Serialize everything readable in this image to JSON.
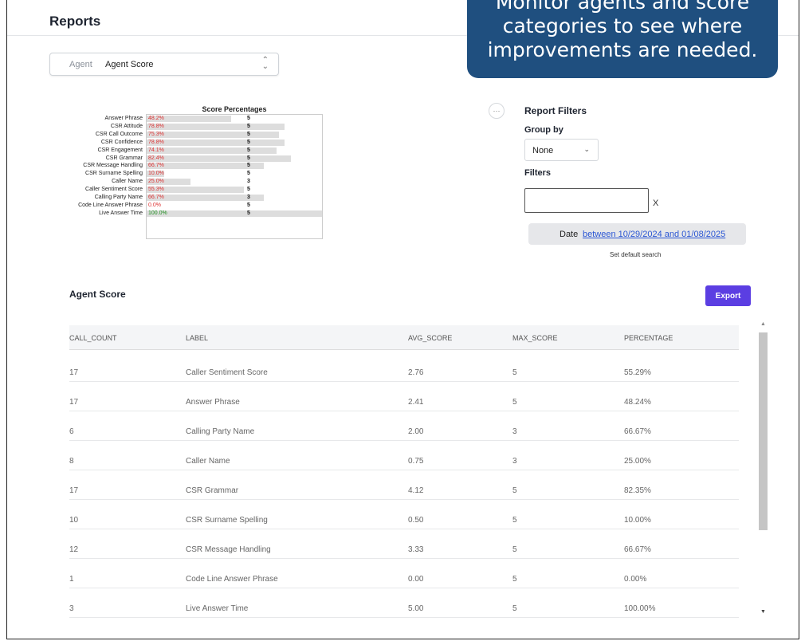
{
  "header": {
    "title": "Reports"
  },
  "callout": {
    "line1": "Monitor agents and score",
    "line2": "categories to see where",
    "line3": "improvements are needed."
  },
  "report_selector": {
    "label": "Agent",
    "value": "Agent Score"
  },
  "chart_data": {
    "type": "bar",
    "title": "Score Percentages",
    "orientation": "horizontal",
    "categories": [
      "Answer Phrase",
      "CSR Attitude",
      "CSR Call Outcome",
      "CSR Confidence",
      "CSR Engagement",
      "CSR Grammar",
      "CSR Message Handling",
      "CSR Surname Spelling",
      "Caller Name",
      "Caller Sentiment Score",
      "Calling Party Name",
      "Code Line Answer Phrase",
      "Live Answer Time"
    ],
    "values": [
      48.2,
      78.8,
      75.3,
      78.8,
      74.1,
      82.4,
      66.7,
      10.0,
      25.0,
      55.3,
      66.7,
      0.0,
      100.0
    ],
    "labels": [
      "48.2%",
      "78.8%",
      "75.3%",
      "78.8%",
      "74.1%",
      "82.4%",
      "66.7%",
      "10.0%",
      "25.0%",
      "55.3%",
      "66.7%",
      "0.0%",
      "100.0%"
    ],
    "max_scores": [
      "5",
      "5",
      "5",
      "5",
      "5",
      "5",
      "5",
      "5",
      "3",
      "5",
      "3",
      "5",
      "5"
    ],
    "xlim": [
      0,
      100
    ],
    "label_colors": {
      "default": "#dd3333",
      "full": "#1a8a1a"
    },
    "bar_color": "#dddddd"
  },
  "filters": {
    "title": "Report Filters",
    "group_by_label": "Group by",
    "group_by_value": "None",
    "filters_label": "Filters",
    "filter_input_value": "",
    "clear_label": "X",
    "date_label": "Date",
    "date_value": "between 10/29/2024 and 01/08/2025",
    "default_search_label": "Set default search"
  },
  "agent_score": {
    "title": "Agent Score",
    "export_label": "Export",
    "columns": [
      "CALL_COUNT",
      "LABEL",
      "AVG_SCORE",
      "MAX_SCORE",
      "PERCENTAGE"
    ],
    "rows": [
      [
        "17",
        "Caller Sentiment Score",
        "2.76",
        "5",
        "55.29%"
      ],
      [
        "17",
        "Answer Phrase",
        "2.41",
        "5",
        "48.24%"
      ],
      [
        "6",
        "Calling Party Name",
        "2.00",
        "3",
        "66.67%"
      ],
      [
        "8",
        "Caller Name",
        "0.75",
        "3",
        "25.00%"
      ],
      [
        "17",
        "CSR Grammar",
        "4.12",
        "5",
        "82.35%"
      ],
      [
        "10",
        "CSR Surname Spelling",
        "0.50",
        "5",
        "10.00%"
      ],
      [
        "12",
        "CSR Message Handling",
        "3.33",
        "5",
        "66.67%"
      ],
      [
        "1",
        "Code Line Answer Phrase",
        "0.00",
        "5",
        "0.00%"
      ],
      [
        "3",
        "Live Answer Time",
        "5.00",
        "5",
        "100.00%"
      ]
    ]
  },
  "icons": {
    "more": "more-horizontal-icon",
    "chevron": "chevron-down-icon",
    "updown": "up-down-chevron-icon",
    "scroll_up": "scroll-up-arrow-icon",
    "scroll_down": "scroll-down-arrow-icon"
  }
}
